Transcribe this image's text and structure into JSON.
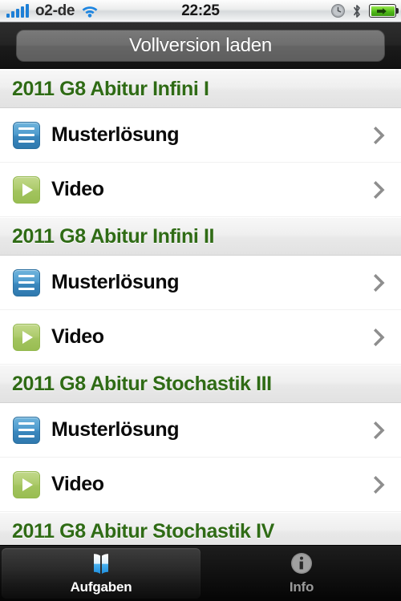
{
  "statusbar": {
    "carrier": "o2-de",
    "time": "22:25",
    "signal_bars": 5,
    "icons": [
      "signal-bars-icon",
      "wifi-icon",
      "alarm-clock-icon",
      "bluetooth-icon",
      "battery-charging-icon"
    ]
  },
  "toolbar": {
    "load_full_version_label": "Vollversion laden"
  },
  "colors": {
    "section_header_text": "#2f6b15",
    "row_text": "#0a0a0a",
    "doc_icon": "#3a87bd",
    "video_icon": "#a2c45e",
    "chevron": "#8e8e8e",
    "accent_blue": "#1d7fd6"
  },
  "list": {
    "sections": [
      {
        "title": "2011 G8 Abitur Infini I",
        "rows": [
          {
            "label": "Musterlösung",
            "icon": "document-icon"
          },
          {
            "label": "Video",
            "icon": "play-icon"
          }
        ]
      },
      {
        "title": "2011 G8 Abitur Infini II",
        "rows": [
          {
            "label": "Musterlösung",
            "icon": "document-icon"
          },
          {
            "label": "Video",
            "icon": "play-icon"
          }
        ]
      },
      {
        "title": "2011 G8 Abitur Stochastik III",
        "rows": [
          {
            "label": "Musterlösung",
            "icon": "document-icon"
          },
          {
            "label": "Video",
            "icon": "play-icon"
          }
        ]
      },
      {
        "title": "2011 G8 Abitur Stochastik IV",
        "rows": []
      }
    ]
  },
  "tabbar": {
    "tabs": [
      {
        "label": "Aufgaben",
        "icon": "book-icon",
        "selected": true
      },
      {
        "label": "Info",
        "icon": "info-icon",
        "selected": false
      }
    ]
  }
}
